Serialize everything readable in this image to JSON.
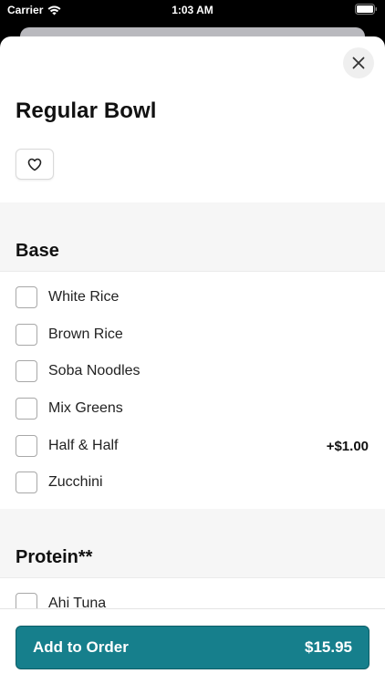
{
  "status_bar": {
    "carrier": "Carrier",
    "time": "1:03 AM"
  },
  "item": {
    "title": "Regular Bowl"
  },
  "sections": [
    {
      "title": "Base",
      "options": [
        {
          "label": "White Rice",
          "price": ""
        },
        {
          "label": "Brown Rice",
          "price": ""
        },
        {
          "label": "Soba Noodles",
          "price": ""
        },
        {
          "label": "Mix Greens",
          "price": ""
        },
        {
          "label": "Half & Half",
          "price": "+$1.00"
        },
        {
          "label": "Zucchini",
          "price": ""
        }
      ]
    },
    {
      "title": "Protein**",
      "options": [
        {
          "label": "Ahi Tuna",
          "price": ""
        }
      ]
    }
  ],
  "footer": {
    "add_label": "Add to Order",
    "total": "$15.95"
  },
  "colors": {
    "accent": "#167f8c",
    "accent_border": "#0d5d67",
    "band": "#f6f6f6"
  }
}
